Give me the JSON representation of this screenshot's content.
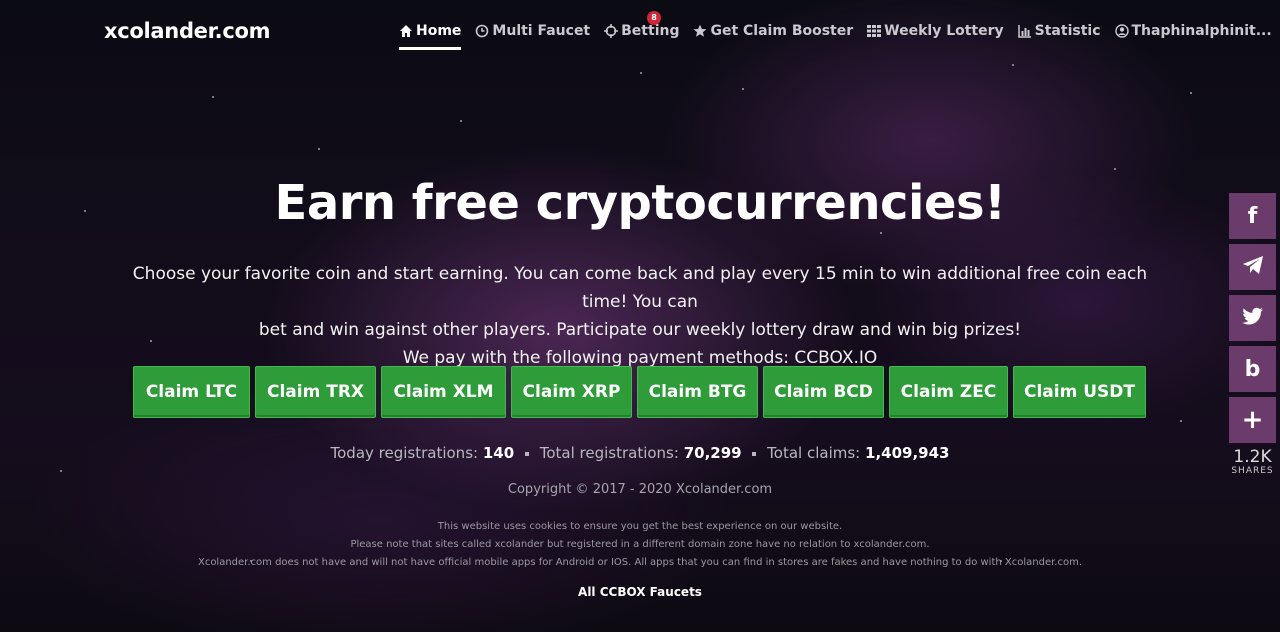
{
  "site": {
    "logo": "xcolander.com"
  },
  "nav": {
    "items": [
      {
        "label": "Home",
        "icon": "home-icon",
        "active": true
      },
      {
        "label": "Multi Faucet",
        "icon": "clock-icon",
        "active": false
      },
      {
        "label": "Betting",
        "icon": "crosshair-icon",
        "active": false
      },
      {
        "label": "Get Claim Booster",
        "icon": "star-icon",
        "active": false
      },
      {
        "label": "Weekly Lottery",
        "icon": "grid-icon",
        "active": false
      },
      {
        "label": "Statistic",
        "icon": "bar-chart-icon",
        "active": false
      },
      {
        "label": "Thaphinalphinit...",
        "icon": "user-icon",
        "active": false
      }
    ],
    "betting_badge": "8"
  },
  "hero": {
    "title": "Earn free cryptocurrencies!",
    "line1": "Choose your favorite coin and start earning. You can come back and play every 15 min to win additional free coin each time! You can",
    "line2": "bet and win against other players. Participate our weekly lottery draw and win big prizes!",
    "line3": "We pay with the following payment methods: CCBOX.IO"
  },
  "claims": [
    "Claim LTC",
    "Claim TRX",
    "Claim XLM",
    "Claim XRP",
    "Claim BTG",
    "Claim BCD",
    "Claim ZEC",
    "Claim USDT"
  ],
  "stats": {
    "today_label": "Today registrations:",
    "today_value": "140",
    "total_label": "Total registrations:",
    "total_value": "70,299",
    "claims_label": "Total claims:",
    "claims_value": "1,409,943"
  },
  "footer": {
    "copyright": "Copyright © 2017 - 2020 Xcolander.com",
    "note1": "This website uses cookies to ensure you get the best experience on our website.",
    "note2": "Please note that sites called xcolander but registered in a different domain zone have no relation to xcolander.com.",
    "note3": "Xcolander.com does not have and will not have official mobile apps for Android or IOS. All apps that you can find in stores are fakes and have nothing to do with Xcolander.com.",
    "all_faucets": "All CCBOX Faucets"
  },
  "share": {
    "buttons": [
      {
        "glyph": "f",
        "icon": "facebook-icon"
      },
      {
        "glyph": "",
        "icon": "telegram-icon"
      },
      {
        "glyph": "",
        "icon": "twitter-icon"
      },
      {
        "glyph": "b",
        "icon": "vk-b-icon"
      },
      {
        "glyph": "+",
        "icon": "plus-icon"
      }
    ],
    "count": "1.2K",
    "label": "SHARES"
  },
  "colors": {
    "claim_green": "#2e9c39",
    "share_purple": "#6b3c6b",
    "badge_red": "#d0263a"
  }
}
